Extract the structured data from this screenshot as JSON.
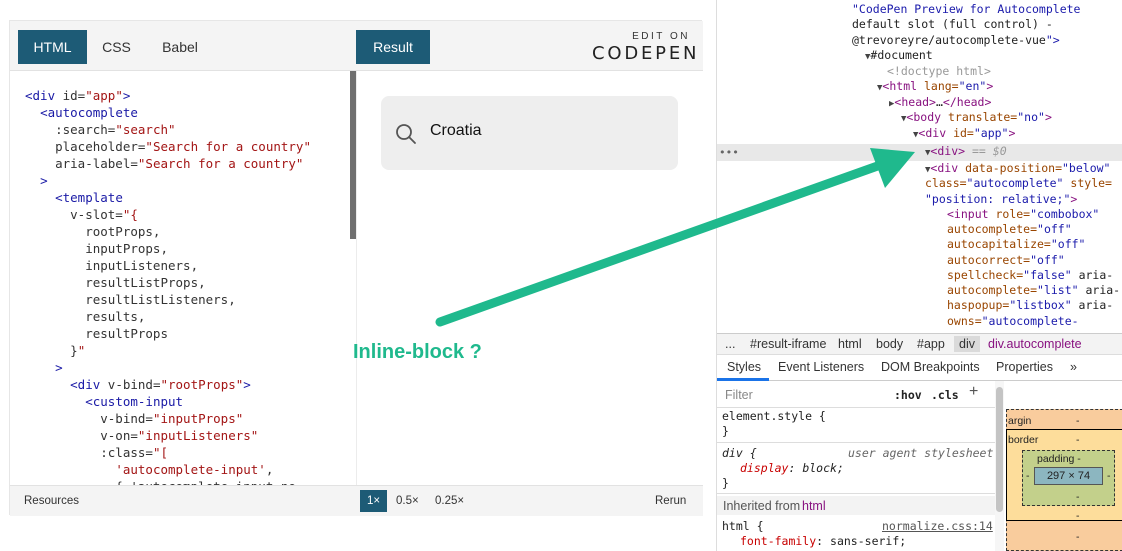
{
  "codepen": {
    "tabs": [
      "HTML",
      "CSS",
      "Babel"
    ],
    "result_tab": "Result",
    "edit_on": "EDIT ON",
    "logo": "CODEPEN",
    "code_lines": [
      "<div id=\"app\">",
      "  <autocomplete",
      "    :search=\"search\"",
      "    placeholder=\"Search for a country\"",
      "    aria-label=\"Search for a country\"",
      "  >",
      "    <template",
      "      v-slot=\"{",
      "        rootProps,",
      "        inputProps,",
      "        inputListeners,",
      "        resultListProps,",
      "        resultListListeners,",
      "        results,",
      "        resultProps",
      "      }\"",
      "    >",
      "      <div v-bind=\"rootProps\">",
      "        <custom-input",
      "          v-bind=\"inputProps\"",
      "          v-on=\"inputListeners\"",
      "          :class=\"[",
      "            'autocomplete-input',",
      "            { 'autocomplete-input-no"
    ],
    "search_value": "Croatia",
    "bottom": {
      "resources": "Resources",
      "zoom_options": [
        "1×",
        "0.5×",
        "0.25×"
      ],
      "zoom_selected": "1×",
      "rerun": "Rerun"
    }
  },
  "annotation": {
    "text": "Inline-block ?",
    "color": "#1fb98d"
  },
  "devtools": {
    "dom_lines": [
      {
        "indent": 0,
        "html": "\"CodePen Preview for Autocomplete"
      },
      {
        "indent": 0,
        "html": "default slot (full control) -"
      },
      {
        "indent": 0,
        "html": "@trevoreyre/autocomplete-vue\">"
      },
      {
        "indent": 1,
        "html": "▼#document"
      },
      {
        "indent": 2,
        "html": "<!doctype html>"
      },
      {
        "indent": 2,
        "html": "▼<html lang=\"en\">"
      },
      {
        "indent": 3,
        "html": "▶<head>…</head>"
      },
      {
        "indent": 3,
        "html": "▼<body translate=\"no\">"
      },
      {
        "indent": 4,
        "html": "▼<div id=\"app\">"
      },
      {
        "indent": 5,
        "html": "▼<div> == $0"
      },
      {
        "indent": 6,
        "html": "▼<div data-position=\"below\""
      },
      {
        "indent": 6,
        "html": "class=\"autocomplete\" style="
      },
      {
        "indent": 6,
        "html": "\"position: relative;\">"
      },
      {
        "indent": 7,
        "html": "<input role=\"combobox\""
      },
      {
        "indent": 7,
        "html": "autocomplete=\"off\""
      },
      {
        "indent": 7,
        "html": "autocapitalize=\"off\""
      },
      {
        "indent": 7,
        "html": "autocorrect=\"off\""
      },
      {
        "indent": 7,
        "html": "spellcheck=\"false\" aria-"
      },
      {
        "indent": 7,
        "html": "autocomplete=\"list\" aria-"
      },
      {
        "indent": 7,
        "html": "haspopup=\"listbox\" aria-"
      },
      {
        "indent": 7,
        "html": "owns=\"autocomplete-"
      }
    ],
    "breadcrumb": [
      "...",
      "#result-iframe",
      "html",
      "body",
      "#app",
      "div",
      "div.autocomplete"
    ],
    "tabs": [
      "Styles",
      "Event Listeners",
      "DOM Breakpoints",
      "Properties",
      "»"
    ],
    "filter_placeholder": "Filter",
    "hov": ":hov",
    "cls": ".cls",
    "plus": "+",
    "element_style": "element.style {",
    "close_brace": "}",
    "div_rule": "div {",
    "ua_label": "user agent stylesheet",
    "display_prop": "display",
    "display_val": "block;",
    "inherited_label": "Inherited from",
    "inherited_from": "html",
    "html_rule": "html {",
    "normalize_link": "normalize.css:14",
    "font_prop": "font-family",
    "font_val": "sans-serif;",
    "boxmodel": {
      "margin_label": "argin",
      "margin_value": "-",
      "border_label": "border",
      "border_value": "-",
      "padding_label": "padding -",
      "content": "297 × 74",
      "side_value": "-",
      "bottom_value": "-"
    }
  }
}
